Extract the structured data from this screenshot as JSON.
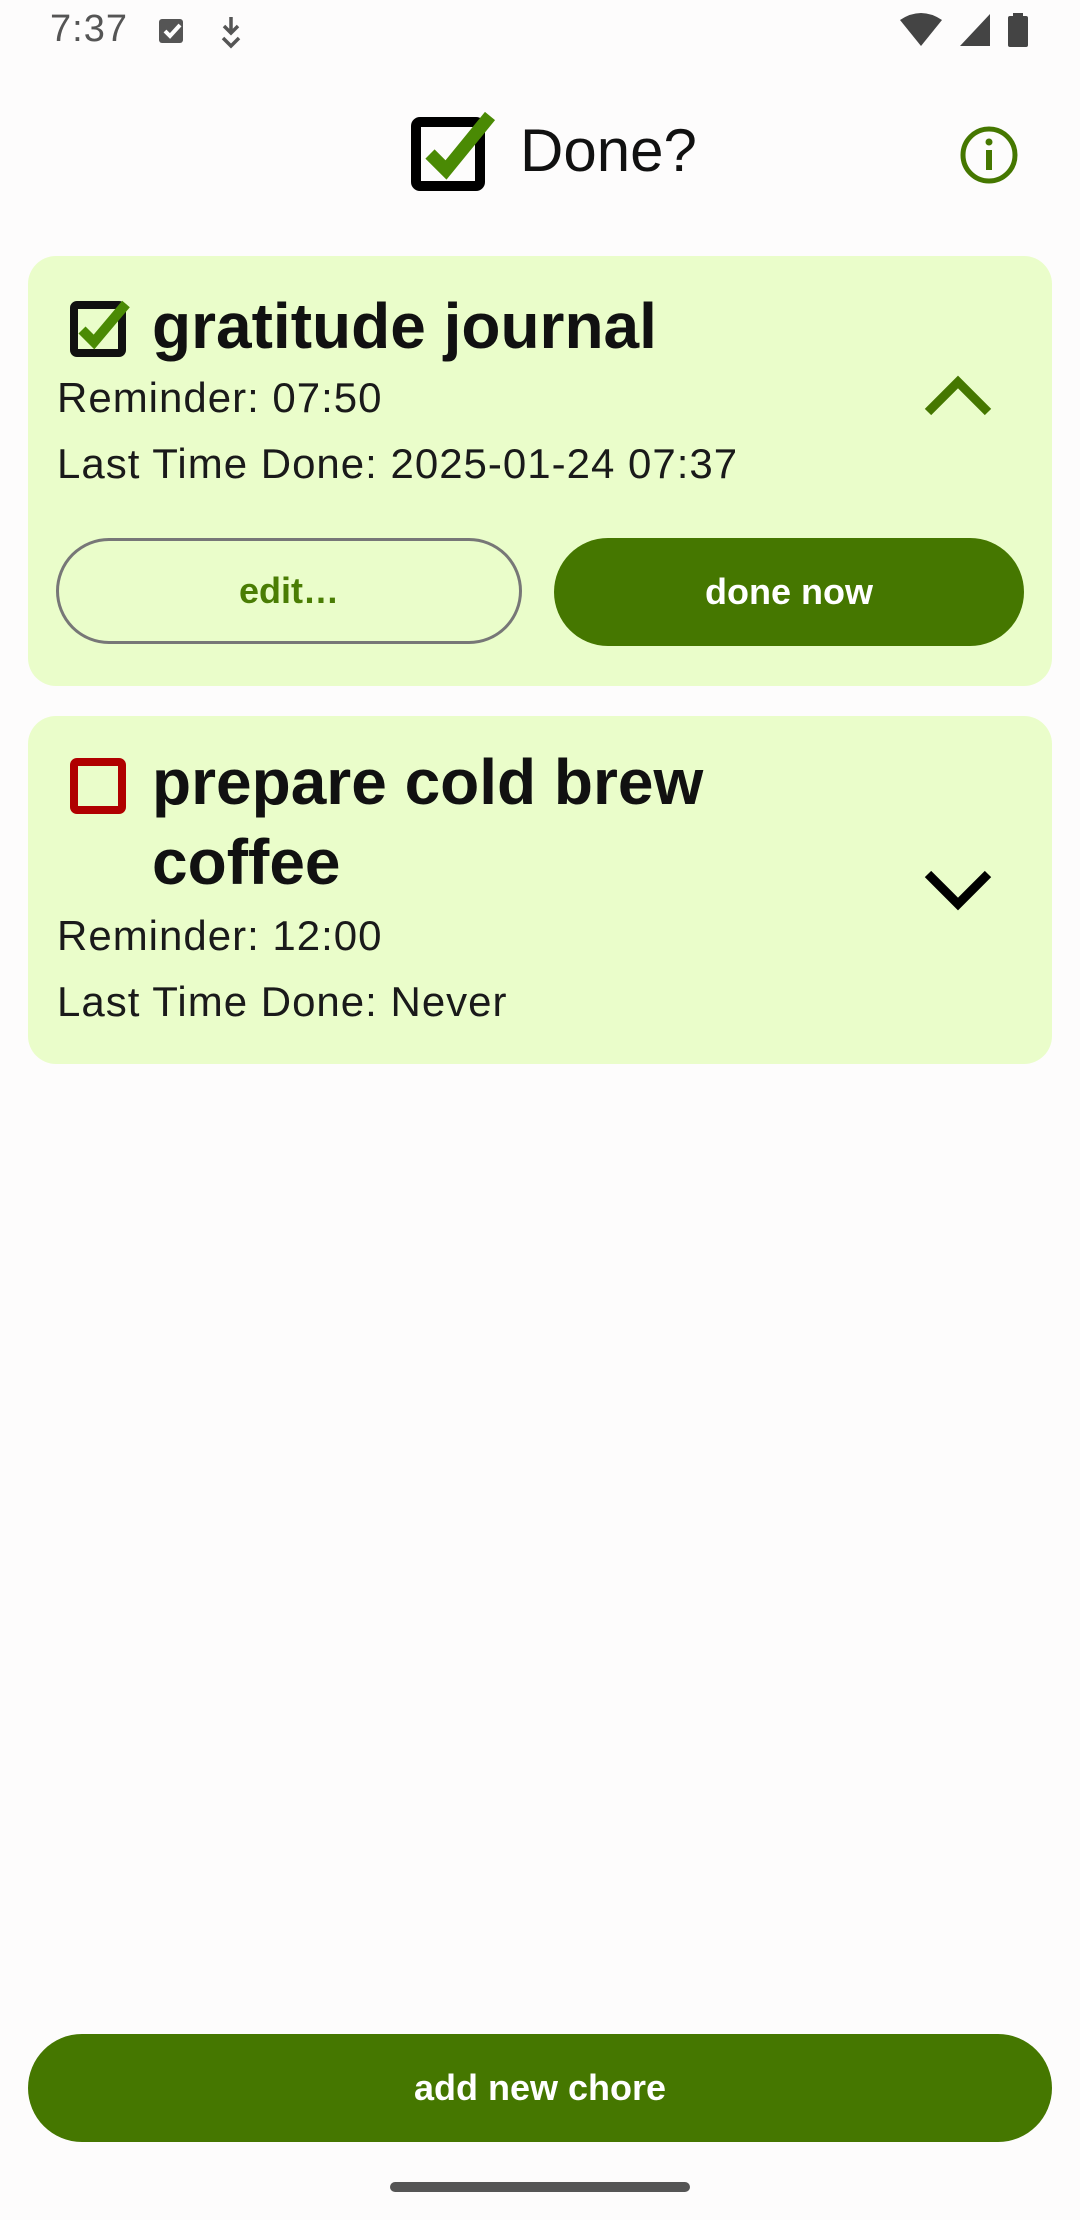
{
  "status_bar": {
    "time": "7:37",
    "icons_left": [
      "checkbox-notification-icon",
      "download-icon"
    ],
    "icons_right": [
      "wifi-icon",
      "signal-icon",
      "battery-icon"
    ]
  },
  "header": {
    "title": "Done?",
    "logo_icon": "checked-box-icon",
    "info_icon": "info-icon"
  },
  "colors": {
    "accent_green": "#457700",
    "card_background": "#eafdca",
    "check_green": "#4a8a04",
    "unchecked_red": "#b00000"
  },
  "chores": [
    {
      "title": "gratitude journal",
      "reminder": "Reminder: 07:50",
      "last_done": "Last Time Done: 2025-01-24 07:37",
      "status_icon": "checked-box-icon",
      "expanded": true,
      "toggle_icon": "chevron-up-icon",
      "edit_label": "edit…",
      "done_label": "done now"
    },
    {
      "title_line1": "prepare cold brew",
      "title_line2": "coffee",
      "reminder": "Reminder: 12:00",
      "last_done": "Last Time Done: Never",
      "status_icon": "unchecked-box-icon",
      "expanded": false,
      "toggle_icon": "chevron-down-icon"
    }
  ],
  "footer": {
    "add_label": "add new chore"
  }
}
